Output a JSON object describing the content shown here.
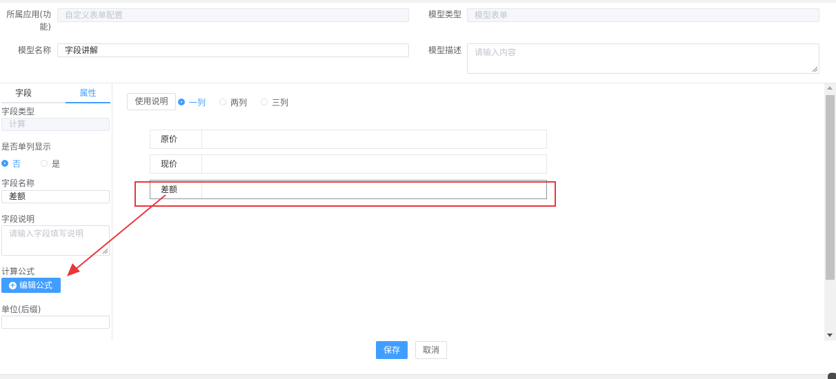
{
  "header": {
    "app_label": "所属应用(功能)",
    "app_value": "自定义表单配置",
    "model_type_label": "模型类型",
    "model_type_value": "模型表单",
    "model_name_label": "模型名称",
    "model_name_value": "字段讲解",
    "model_desc_label": "模型描述",
    "model_desc_placeholder": "请输入内容"
  },
  "sidebar": {
    "tabs": [
      {
        "label": "字段",
        "active": false
      },
      {
        "label": "属性",
        "active": true
      }
    ],
    "field_type_label": "字段类型",
    "field_type_value": "计算",
    "single_column_label": "是否单列显示",
    "single_column_options": [
      {
        "label": "否",
        "selected": true
      },
      {
        "label": "是",
        "selected": false
      }
    ],
    "field_name_label": "字段名称",
    "field_name_value": "差额",
    "field_desc_label": "字段说明",
    "field_desc_placeholder": "请输入字段填写说明",
    "formula_label": "计算公式",
    "edit_formula_button": "编辑公式",
    "unit_label": "单位(后缀)",
    "unit_value": ""
  },
  "main": {
    "usage_button": "使用说明",
    "column_options": [
      {
        "label": "一列",
        "selected": true
      },
      {
        "label": "两列",
        "selected": false
      },
      {
        "label": "三列",
        "selected": false
      }
    ],
    "fields": [
      {
        "label": "原价"
      },
      {
        "label": "现价"
      },
      {
        "label": "差额"
      }
    ]
  },
  "footer": {
    "save_button": "保存",
    "cancel_button": "取消"
  },
  "colors": {
    "primary": "#409eff",
    "highlight": "#e8363b",
    "border": "#dcdfe6"
  }
}
